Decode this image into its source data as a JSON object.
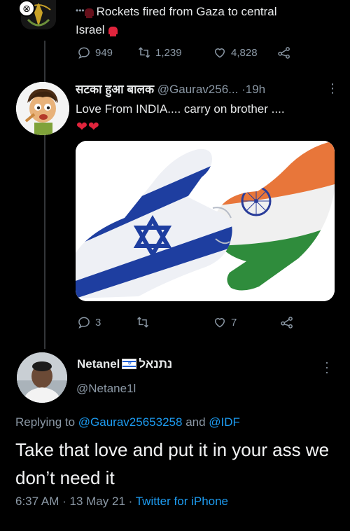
{
  "top_tweet": {
    "close_symbol": "⊗",
    "more_symbol": "•••",
    "text_line1": "Rockets fired from Gaza to central",
    "text_line2": "Israel",
    "stats": {
      "replies": "949",
      "retweets": "1,239",
      "likes": "4,828"
    }
  },
  "reply1": {
    "display_name": "सटका हुआ बालक",
    "handle": "@Gaurav256...",
    "separator": "·",
    "time": "19h",
    "more_symbol": "⋮",
    "text": "Love From INDIA.... carry on brother ....",
    "emoji": "❤❤",
    "stats": {
      "replies": "3",
      "retweets": "",
      "likes": "7"
    }
  },
  "reply2": {
    "display_name": "Netanel",
    "hebrew_name": "נתנאל",
    "handle": "@Netane1l",
    "replying_prefix": "Replying to",
    "mention1": "@Gaurav25653258",
    "and_word": "and",
    "mention2": "@IDF",
    "text": "Take that love and put it in your ass we don’t need it",
    "time": "6:37 AM",
    "date": "13 May 21",
    "client": "Twitter for iPhone",
    "dot": "·"
  },
  "colors": {
    "background": "#000000",
    "text": "#e7e9ea",
    "muted": "#8b98a5",
    "link": "#1d9bf0",
    "heart": "#e0243c"
  },
  "icons": [
    "close-icon",
    "reply-icon",
    "retweet-icon",
    "like-icon",
    "share-icon",
    "more-icon",
    "siren-emoji",
    "israel-flag-emoji"
  ]
}
